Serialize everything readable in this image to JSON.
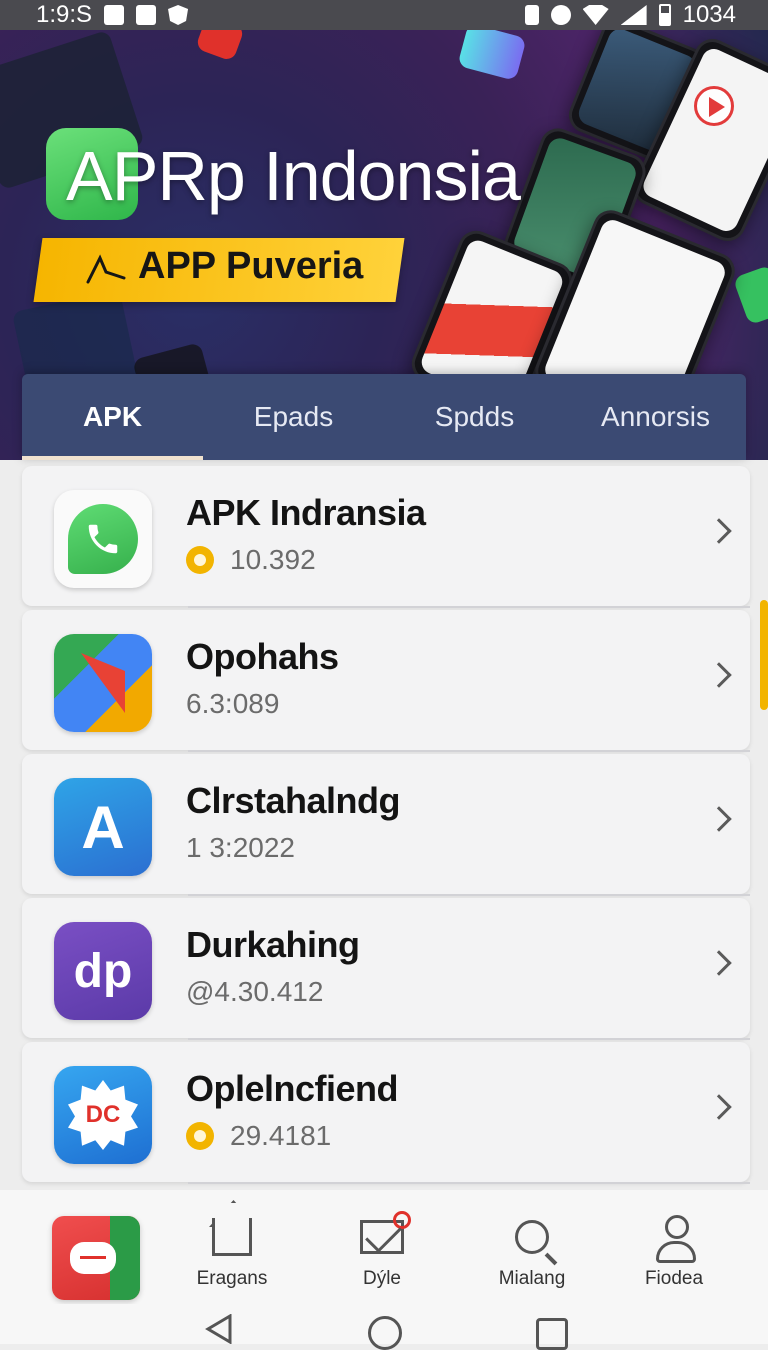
{
  "status_bar": {
    "time": "1:9:S",
    "battery_text": "1034"
  },
  "banner": {
    "title": "APRp Indonsia",
    "ribbon": "APP Puveria"
  },
  "tabs": [
    {
      "label": "APK",
      "active": true
    },
    {
      "label": "Epads",
      "active": false
    },
    {
      "label": "Spdds",
      "active": false
    },
    {
      "label": "Annorsis",
      "active": false
    }
  ],
  "apps": [
    {
      "name": "APK Indransia",
      "meta": "10.392",
      "icon": "whatsapp-icon",
      "has_badge": true
    },
    {
      "name": "Opohahs",
      "meta": "6.3:089",
      "icon": "maps-icon",
      "has_badge": false
    },
    {
      "name": "Clrstahalndg",
      "meta": "1 3:2022",
      "icon": "app-store-icon",
      "has_badge": false
    },
    {
      "name": "Durkahing",
      "meta": "@4.30.412",
      "icon": "dp-icon",
      "has_badge": false
    },
    {
      "name": "Oplelncfiend",
      "meta": "29.4181",
      "icon": "dc-icon",
      "has_badge": true
    }
  ],
  "icon_text": {
    "store": "A",
    "dp": "dp",
    "dc": "DC"
  },
  "bottom_nav": [
    {
      "label": "Eragans",
      "icon": "home-icon"
    },
    {
      "label": "Dýle",
      "icon": "mail-icon"
    },
    {
      "label": "Mialang",
      "icon": "search-icon"
    },
    {
      "label": "Fiodea",
      "icon": "profile-icon"
    }
  ],
  "colors": {
    "tab_bar": "#3b4a73",
    "accent_yellow": "#f2b400",
    "brand_green": "#36b04c",
    "alert_red": "#e0312b"
  }
}
